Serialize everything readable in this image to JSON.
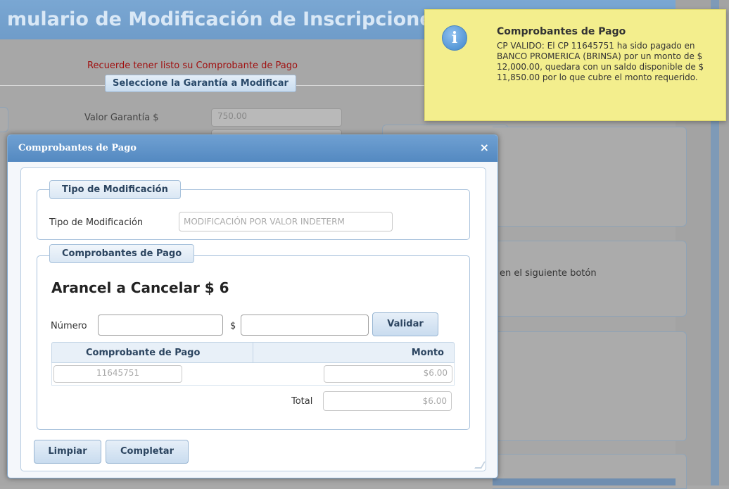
{
  "page": {
    "title": "mulario de Modificación de Inscripciones",
    "reminder": "Recuerde tener listo su Comprobante de Pago",
    "garantia_legend": "Seleccione la Garantía a Modificar",
    "valor_garantia_label": "Valor Garantía $",
    "valor_garantia_value": "750.00",
    "side_text": "en el siguiente botón"
  },
  "dialog": {
    "title": "Comprobantes de Pago",
    "close_glyph": "×",
    "tipo": {
      "legend": "Tipo de Modificación",
      "label": "Tipo de Modificación",
      "value": "MODIFICACIÓN POR VALOR INDETERM"
    },
    "comprobantes": {
      "legend": "Comprobantes de Pago",
      "arancel": "Arancel a Cancelar $ 6",
      "numero_label": "Número",
      "currency_label": "$",
      "validar_label": "Validar",
      "table": {
        "columns": [
          "Comprobante de Pago",
          "Monto"
        ],
        "rows": [
          {
            "comprobante": "11645751",
            "monto": "$6.00"
          }
        ]
      },
      "total_label": "Total",
      "total_value": "$6.00"
    },
    "buttons": {
      "limpiar": "Limpiar",
      "completar": "Completar"
    }
  },
  "notification": {
    "icon": "info-icon",
    "icon_glyph": "i",
    "title": "Comprobantes de Pago",
    "message": "CP VALIDO: El CP 11645751 ha sido pagado en BANCO PROMERICA (BRINSA) por un monto de $ 12,000.00, quedara con un saldo disponible de $ 11,850.00 por lo que cubre el monto requerido."
  },
  "colors": {
    "notification_bg": "#f3ee8d",
    "dialog_header": "#5f93c9",
    "reminder_text": "#a01010"
  }
}
